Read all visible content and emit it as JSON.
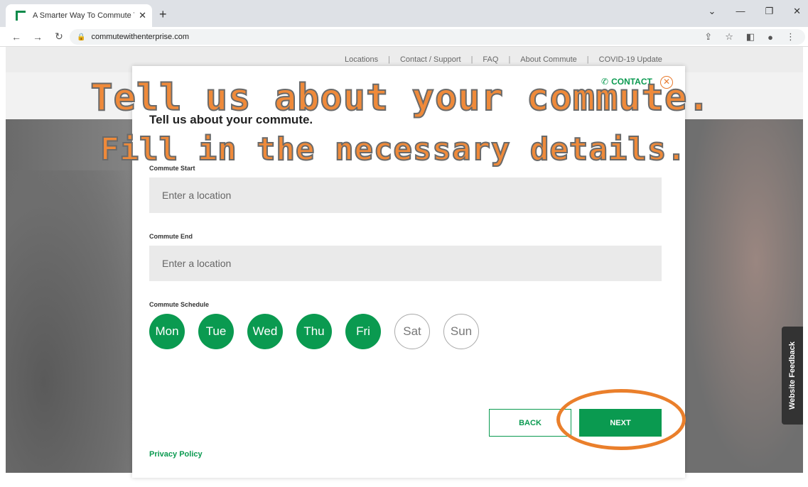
{
  "browser": {
    "tab_title": "A Smarter Way To Commute To W",
    "tab_close": "✕",
    "new_tab": "+",
    "url": "commutewithenterprise.com",
    "controls": [
      "⌄",
      "—",
      "❐",
      "✕"
    ]
  },
  "top_nav": [
    "Locations",
    "Contact / Support",
    "FAQ",
    "About Commute",
    "COVID-19 Update"
  ],
  "card": {
    "contact_label": "CONTACT",
    "heading": "Tell us about your commute.",
    "start_label": "Commute Start",
    "start_placeholder": "Enter a location",
    "end_label": "Commute End",
    "end_placeholder": "Enter a location",
    "schedule_label": "Commute Schedule",
    "days": [
      {
        "label": "Mon",
        "selected": true
      },
      {
        "label": "Tue",
        "selected": true
      },
      {
        "label": "Wed",
        "selected": true
      },
      {
        "label": "Thu",
        "selected": true
      },
      {
        "label": "Fri",
        "selected": true
      },
      {
        "label": "Sat",
        "selected": false
      },
      {
        "label": "Sun",
        "selected": false
      }
    ],
    "back_label": "BACK",
    "next_label": "NEXT",
    "privacy_label": "Privacy Policy"
  },
  "feedback_label": "Website Feedback",
  "overlay": {
    "line1": "Tell us about your commute.",
    "line2": "Fill in the necessary details."
  },
  "colors": {
    "brand_green": "#0a9a50",
    "annotation_orange": "#ef8a3a"
  }
}
